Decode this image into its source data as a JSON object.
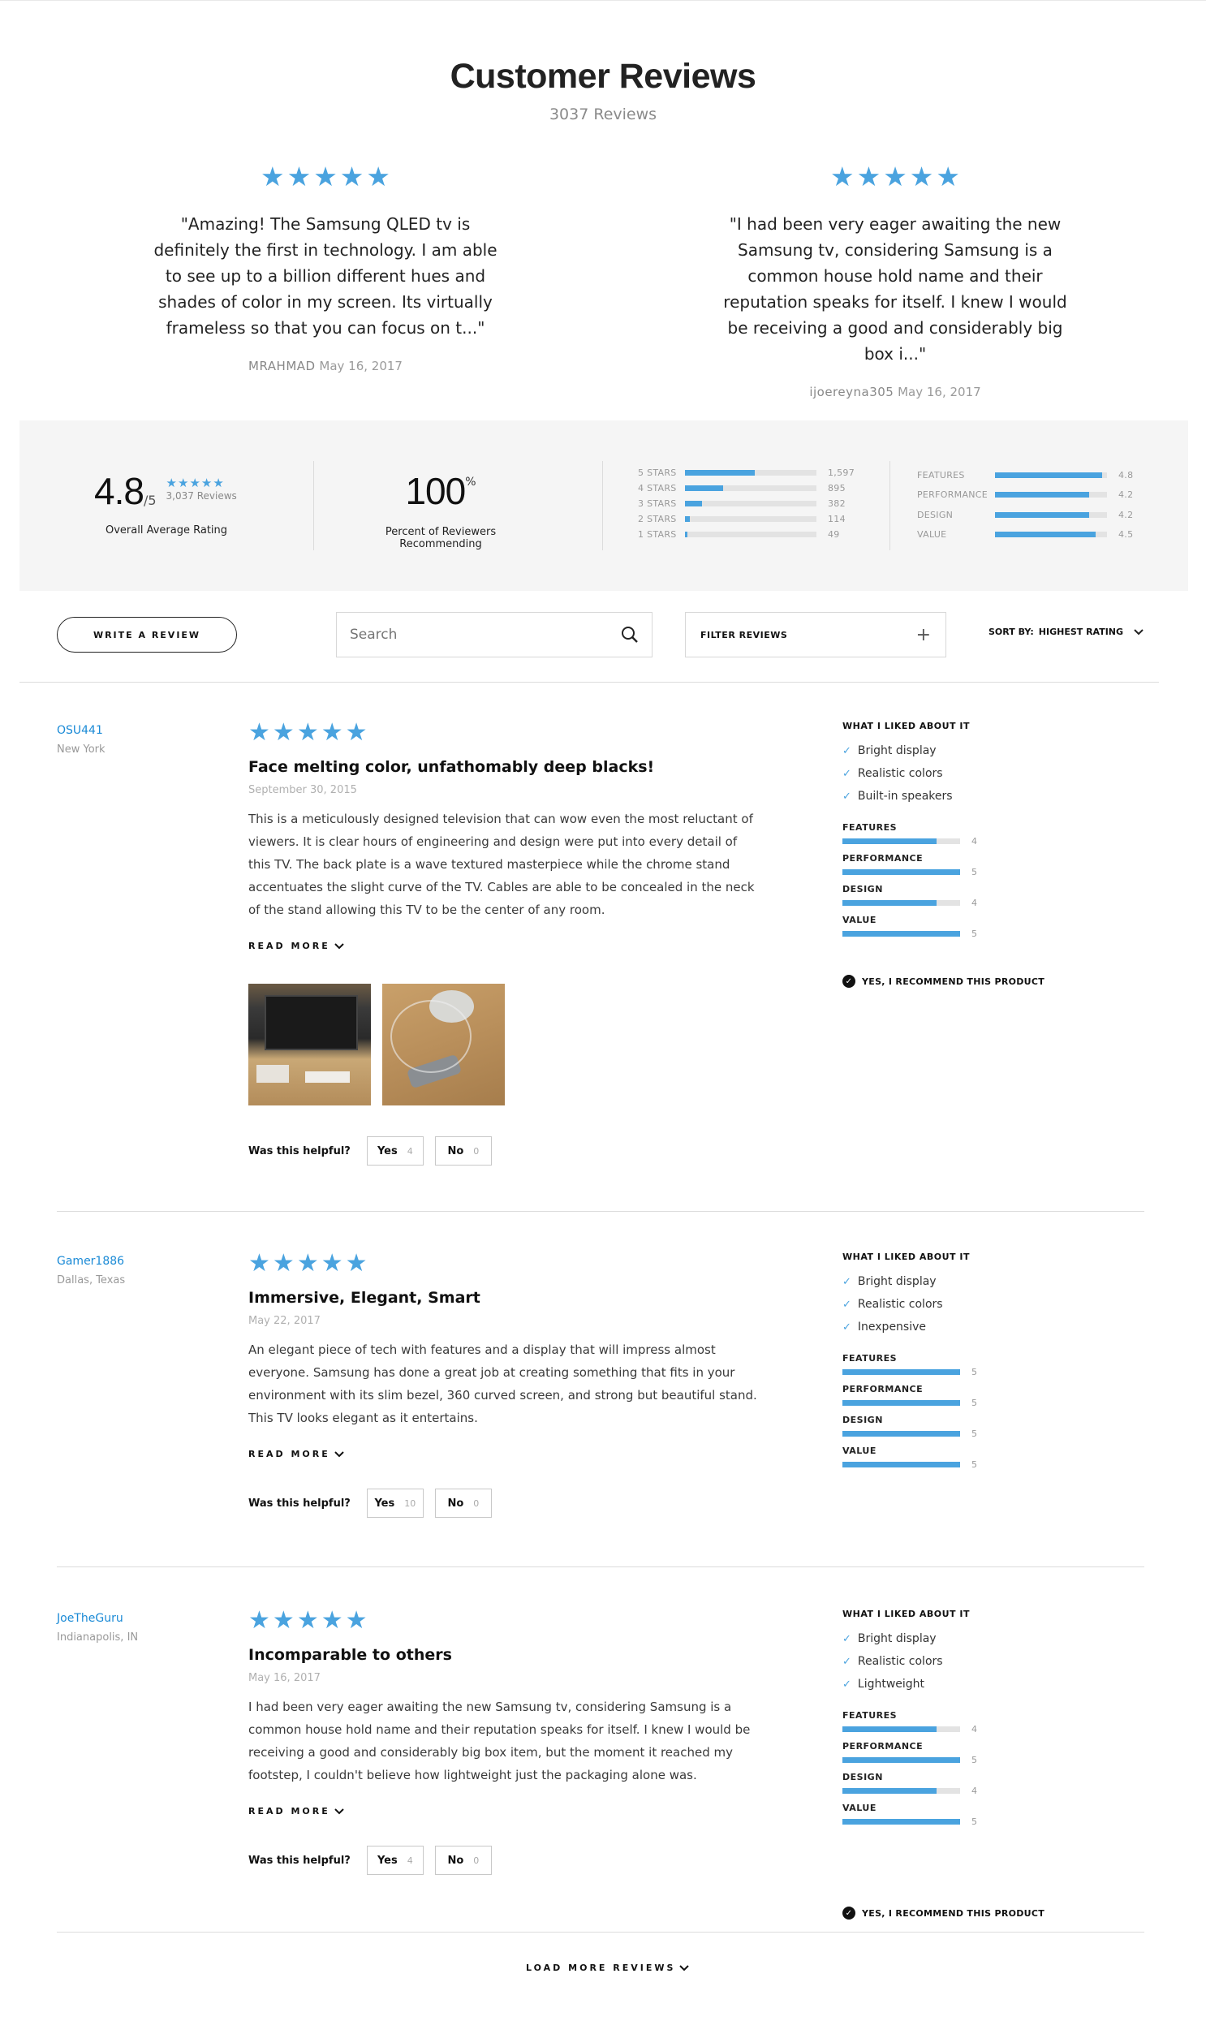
{
  "header": {
    "title": "Customer Reviews",
    "subtitle": "3037 Reviews"
  },
  "featured": [
    {
      "stars": 5,
      "quote": "\"Amazing! The Samsung QLED tv is definitely the first in technology. I am able to see up to a billion different hues and shades of color in my screen. Its virtually frameless so that you can focus on t...\"",
      "author": "MRAHMAD",
      "date": "May 16, 2017"
    },
    {
      "stars": 5,
      "quote": "\"I had been very eager awaiting the new Samsung tv, considering Samsung is a common house hold name and their reputation speaks for itself. I knew I would be receiving a good and considerably big box i...\"",
      "author": "ijoereyna305",
      "date": "May 16, 2017"
    }
  ],
  "summary": {
    "avg": "4.8",
    "avg_of": "/5",
    "count_text": "3,037 Reviews",
    "avg_label": "Overall Average Rating",
    "recommend_pct": "100",
    "recommend_unit": "%",
    "recommend_label": "Percent of Reviewers Recommending",
    "histogram": [
      {
        "label": "5 STARS",
        "count": "1,597",
        "fraction": 0.53
      },
      {
        "label": "4 STARS",
        "count": "895",
        "fraction": 0.29
      },
      {
        "label": "3 STARS",
        "count": "382",
        "fraction": 0.13
      },
      {
        "label": "2 STARS",
        "count": "114",
        "fraction": 0.04
      },
      {
        "label": "1 STARS",
        "count": "49",
        "fraction": 0.02
      }
    ],
    "attributes": [
      {
        "label": "FEATURES",
        "value": "4.8",
        "fraction": 0.96
      },
      {
        "label": "PERFORMANCE",
        "value": "4.2",
        "fraction": 0.84
      },
      {
        "label": "DESIGN",
        "value": "4.2",
        "fraction": 0.84
      },
      {
        "label": "VALUE",
        "value": "4.5",
        "fraction": 0.9
      }
    ]
  },
  "toolbar": {
    "write_review": "WRITE A REVIEW",
    "search_placeholder": "Search",
    "filter_label": "FILTER REVIEWS",
    "sort_prefix": "SORT BY:",
    "sort_value": "HIGHEST RATING"
  },
  "reviews": [
    {
      "name": "OSU441",
      "location": "New York",
      "stars": 5,
      "title": "Face melting color, unfathomably deep blacks!",
      "date": "September 30, 2015",
      "body": "This is a meticulously designed television that can wow even the most reluctant of viewers. It is clear hours of engineering and design were put into every detail of this TV. The back plate is a wave textured masterpiece while the chrome stand accentuates the slight curve of the TV. Cables are able to be concealed in the neck of the stand allowing this TV to be the center of any room.",
      "read_more": "READ MORE",
      "helpful_label": "Was this helpful?",
      "yes_label": "Yes",
      "yes_count": "4",
      "no_label": "No",
      "no_count": "0",
      "liked_heading": "WHAT I LIKED ABOUT IT",
      "liked": [
        "Bright display",
        "Realistic colors",
        "Built-in speakers"
      ],
      "attrs": [
        {
          "label": "FEATURES",
          "value": "4",
          "fraction": 0.8
        },
        {
          "label": "PERFORMANCE",
          "value": "5",
          "fraction": 1
        },
        {
          "label": "DESIGN",
          "value": "4",
          "fraction": 0.8
        },
        {
          "label": "VALUE",
          "value": "5",
          "fraction": 1
        }
      ],
      "recommend": "YES, I RECOMMEND THIS PRODUCT"
    },
    {
      "name": "Gamer1886",
      "location": "Dallas, Texas",
      "stars": 5,
      "title": "Immersive, Elegant, Smart",
      "date": "May 22, 2017",
      "body": "An elegant piece of tech with features and a display that will impress almost everyone. Samsung has done a great job at creating something that fits in your environment with its slim bezel, 360 curved screen, and strong but beautiful stand. This TV looks elegant as it entertains.",
      "read_more": "READ MORE",
      "helpful_label": "Was this helpful?",
      "yes_label": "Yes",
      "yes_count": "10",
      "no_label": "No",
      "no_count": "0",
      "liked_heading": "WHAT I LIKED ABOUT IT",
      "liked": [
        "Bright display",
        "Realistic colors",
        "Inexpensive"
      ],
      "attrs": [
        {
          "label": "FEATURES",
          "value": "5",
          "fraction": 1
        },
        {
          "label": "PERFORMANCE",
          "value": "5",
          "fraction": 1
        },
        {
          "label": "DESIGN",
          "value": "5",
          "fraction": 1
        },
        {
          "label": "VALUE",
          "value": "5",
          "fraction": 1
        }
      ]
    },
    {
      "name": "JoeTheGuru",
      "location": "Indianapolis, IN",
      "stars": 5,
      "title": "Incomparable to others",
      "date": "May 16, 2017",
      "body": "I had been very eager awaiting the new Samsung tv, considering Samsung is a common house hold name and their reputation speaks for itself. I knew I would be receiving a good and considerably big box item, but the moment it reached my footstep, I couldn't believe how lightweight just the packaging alone was.",
      "read_more": "READ MORE",
      "helpful_label": "Was this helpful?",
      "yes_label": "Yes",
      "yes_count": "4",
      "no_label": "No",
      "no_count": "0",
      "liked_heading": "WHAT I LIKED ABOUT IT",
      "liked": [
        "Bright display",
        "Realistic colors",
        "Lightweight"
      ],
      "attrs": [
        {
          "label": "FEATURES",
          "value": "4",
          "fraction": 0.8
        },
        {
          "label": "PERFORMANCE",
          "value": "5",
          "fraction": 1
        },
        {
          "label": "DESIGN",
          "value": "4",
          "fraction": 0.8
        },
        {
          "label": "VALUE",
          "value": "5",
          "fraction": 1
        }
      ],
      "recommend": "YES, I RECOMMEND THIS PRODUCT"
    }
  ],
  "load_more": "LOAD MORE REVIEWS",
  "colors": {
    "accent": "#4aa3df",
    "link": "#1a8ad6",
    "panel": "#f5f5f5"
  }
}
